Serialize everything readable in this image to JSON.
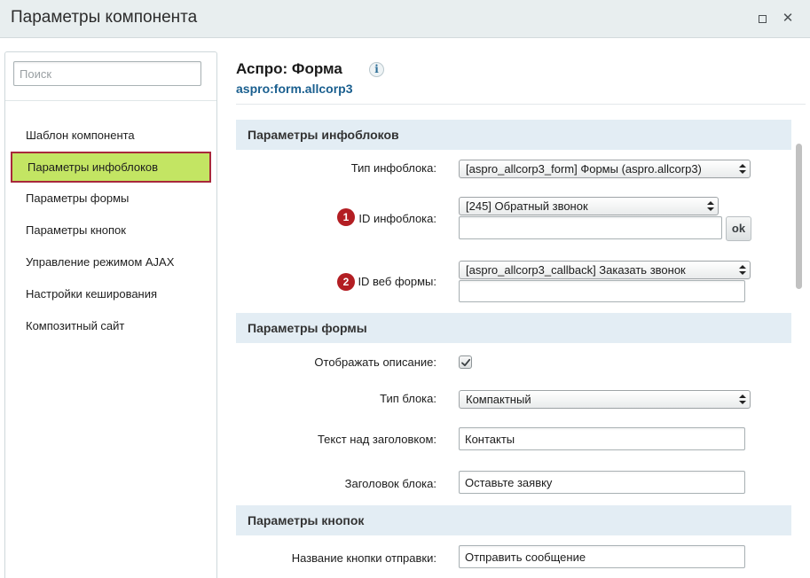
{
  "window": {
    "title": "Параметры компонента",
    "maximize_icon": "maximize-icon",
    "close_icon": "close-icon"
  },
  "sidebar": {
    "search_placeholder": "Поиск",
    "items": [
      {
        "label": "Шаблон компонента",
        "active": false
      },
      {
        "label": "Параметры инфоблоков",
        "active": true
      },
      {
        "label": "Параметры формы",
        "active": false
      },
      {
        "label": "Параметры кнопок",
        "active": false
      },
      {
        "label": "Управление режимом AJAX",
        "active": false
      },
      {
        "label": "Настройки кеширования",
        "active": false
      },
      {
        "label": "Композитный сайт",
        "active": false
      }
    ]
  },
  "component": {
    "title": "Аспро: Форма",
    "info_symbol": "i",
    "code": "aspro:form.allcorp3"
  },
  "sections": {
    "infoblocks": {
      "header": "Параметры инфоблоков",
      "iblock_type_label": "Тип инфоблока:",
      "iblock_type_value": "[aspro_allcorp3_form] Формы (aspro.allcorp3)",
      "iblock_id_badge": "1",
      "iblock_id_label": "ID инфоблока:",
      "iblock_id_value": "[245] Обратный звонок",
      "iblock_id_input": "",
      "ok_label": "ok",
      "webform_badge": "2",
      "webform_label": "ID веб формы:",
      "webform_value": "[aspro_allcorp3_callback] Заказать звонок",
      "webform_input": ""
    },
    "form": {
      "header": "Параметры формы",
      "show_desc_label": "Отображать описание:",
      "show_desc_checked": true,
      "block_type_label": "Тип блока:",
      "block_type_value": "Компактный",
      "text_above_label": "Текст над заголовком:",
      "text_above_value": "Контакты",
      "block_title_label": "Заголовок блока:",
      "block_title_value": "Оставьте заявку"
    },
    "buttons": {
      "header": "Параметры кнопок",
      "submit_label": "Название кнопки отправки:",
      "submit_value": "Отправить сообщение"
    }
  },
  "colors": {
    "active_item_bg": "#c3e563",
    "active_item_border": "#a8283b",
    "badge": "#b31e23",
    "component_code": "#1a5f8f",
    "section_header_bg": "#e3edf4"
  }
}
